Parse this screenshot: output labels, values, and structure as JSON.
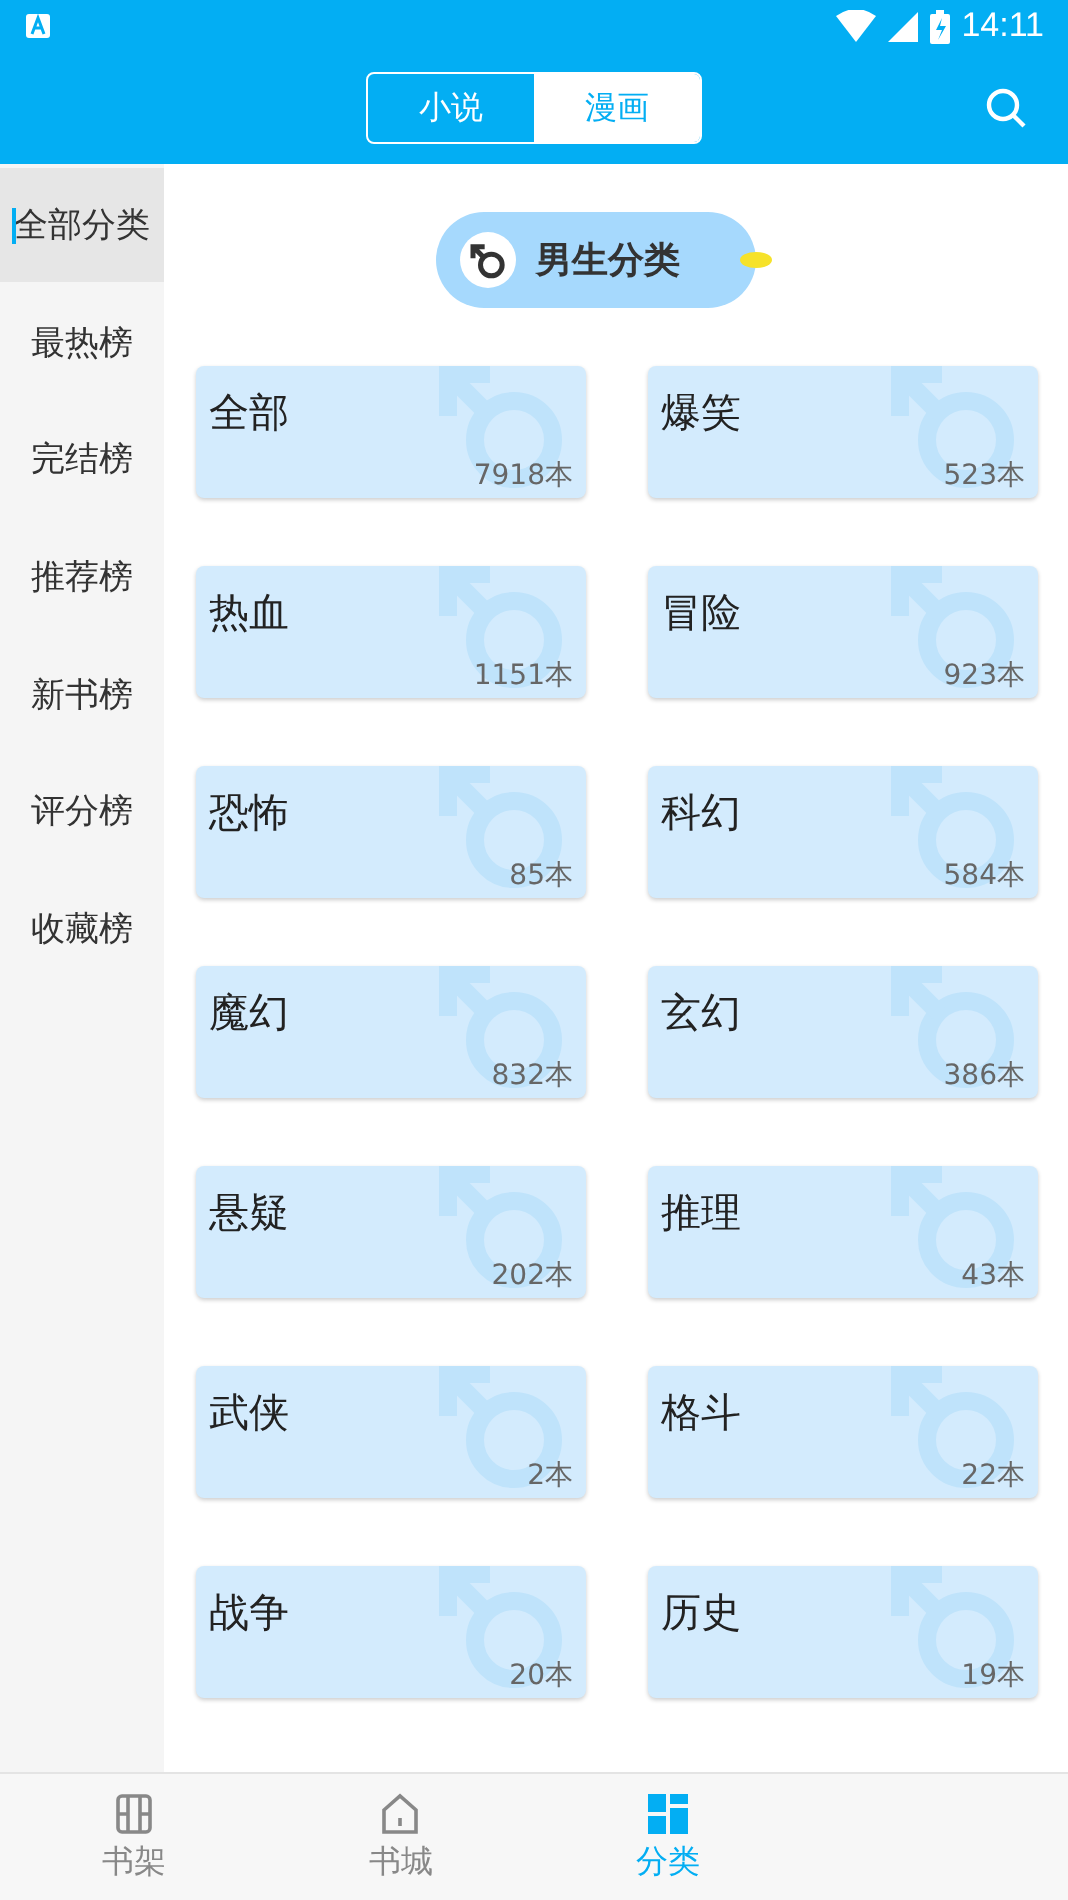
{
  "status_bar": {
    "time": "14:11"
  },
  "header": {
    "tabs": [
      {
        "label": "小说",
        "selected": false
      },
      {
        "label": "漫画",
        "selected": true
      }
    ]
  },
  "sidebar": {
    "items": [
      {
        "label": "全部分类",
        "selected": true
      },
      {
        "label": "最热榜",
        "selected": false
      },
      {
        "label": "完结榜",
        "selected": false
      },
      {
        "label": "推荐榜",
        "selected": false
      },
      {
        "label": "新书榜",
        "selected": false
      },
      {
        "label": "评分榜",
        "selected": false
      },
      {
        "label": "收藏榜",
        "selected": false
      }
    ]
  },
  "section": {
    "title": "男生分类"
  },
  "categories": [
    {
      "name": "全部",
      "count": "7918本"
    },
    {
      "name": "爆笑",
      "count": "523本"
    },
    {
      "name": "热血",
      "count": "1151本"
    },
    {
      "name": "冒险",
      "count": "923本"
    },
    {
      "name": "恐怖",
      "count": "85本"
    },
    {
      "name": "科幻",
      "count": "584本"
    },
    {
      "name": "魔幻",
      "count": "832本"
    },
    {
      "name": "玄幻",
      "count": "386本"
    },
    {
      "name": "悬疑",
      "count": "202本"
    },
    {
      "name": "推理",
      "count": "43本"
    },
    {
      "name": "武侠",
      "count": "2本"
    },
    {
      "name": "格斗",
      "count": "22本"
    },
    {
      "name": "战争",
      "count": "20本"
    },
    {
      "name": "历史",
      "count": "19本"
    }
  ],
  "bottom_nav": [
    {
      "label": "书架",
      "kind": "shelf",
      "selected": false
    },
    {
      "label": "书城",
      "kind": "home",
      "selected": false
    },
    {
      "label": "分类",
      "kind": "grid",
      "selected": true
    }
  ]
}
